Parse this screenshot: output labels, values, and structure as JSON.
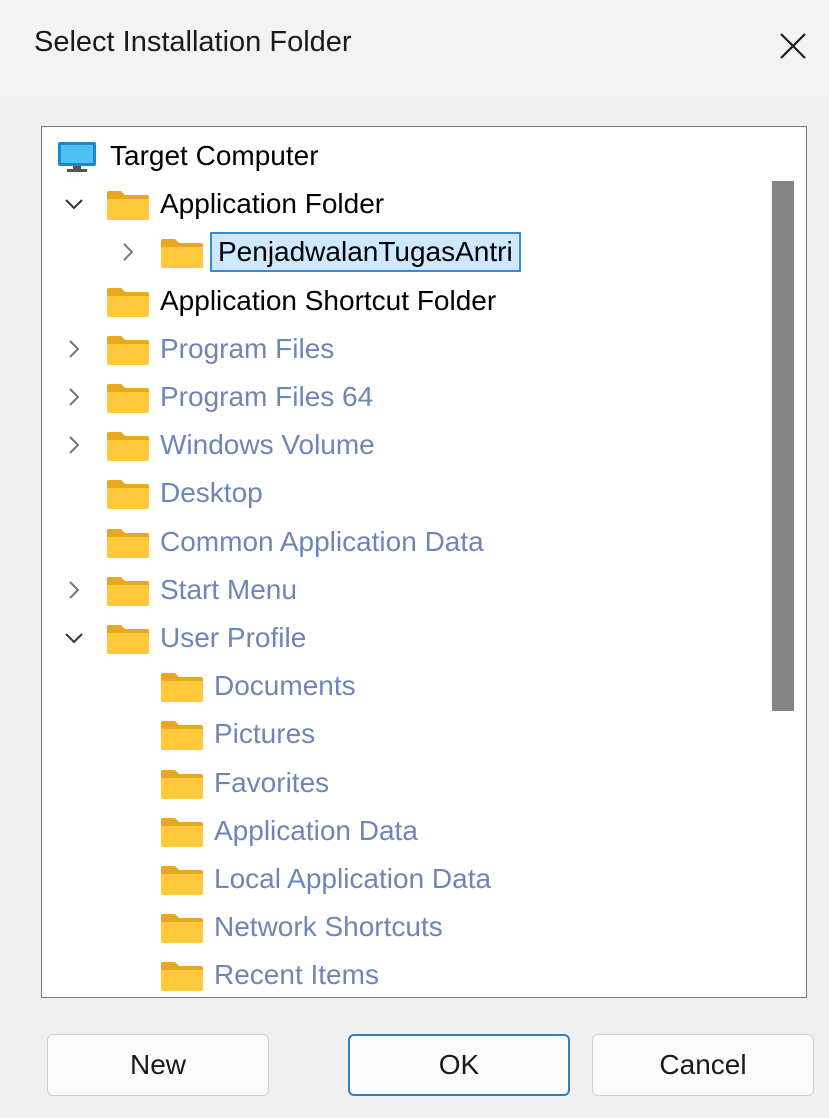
{
  "window": {
    "title": "Select Installation Folder",
    "close_glyph": "✕"
  },
  "tree": {
    "items": [
      {
        "label": "Target Computer",
        "icon": "computer-icon",
        "level": 0,
        "expander": "none",
        "style": "dark",
        "selected": false
      },
      {
        "label": "Application Folder",
        "icon": "folder-icon",
        "level": 1,
        "expander": "expanded",
        "style": "dark",
        "selected": false
      },
      {
        "label": "PenjadwalanTugasAntri",
        "icon": "folder-icon",
        "level": 2,
        "expander": "collapsed",
        "style": "dark",
        "selected": true
      },
      {
        "label": "Application Shortcut Folder",
        "icon": "folder-icon",
        "level": 1,
        "expander": "none",
        "style": "dark",
        "selected": false
      },
      {
        "label": "Program Files",
        "icon": "folder-icon",
        "level": 1,
        "expander": "collapsed",
        "style": "gray",
        "selected": false
      },
      {
        "label": "Program Files 64",
        "icon": "folder-icon",
        "level": 1,
        "expander": "collapsed",
        "style": "gray",
        "selected": false
      },
      {
        "label": "Windows Volume",
        "icon": "folder-icon",
        "level": 1,
        "expander": "collapsed",
        "style": "gray",
        "selected": false
      },
      {
        "label": "Desktop",
        "icon": "folder-icon",
        "level": 1,
        "expander": "none",
        "style": "gray",
        "selected": false
      },
      {
        "label": "Common Application Data",
        "icon": "folder-icon",
        "level": 1,
        "expander": "none",
        "style": "gray",
        "selected": false
      },
      {
        "label": "Start Menu",
        "icon": "folder-icon",
        "level": 1,
        "expander": "collapsed",
        "style": "gray",
        "selected": false
      },
      {
        "label": "User Profile",
        "icon": "folder-icon",
        "level": 1,
        "expander": "expanded",
        "style": "gray",
        "selected": false
      },
      {
        "label": "Documents",
        "icon": "folder-icon",
        "level": 2,
        "expander": "none",
        "style": "gray",
        "selected": false
      },
      {
        "label": "Pictures",
        "icon": "folder-icon",
        "level": 2,
        "expander": "none",
        "style": "gray",
        "selected": false
      },
      {
        "label": "Favorites",
        "icon": "folder-icon",
        "level": 2,
        "expander": "none",
        "style": "gray",
        "selected": false
      },
      {
        "label": "Application Data",
        "icon": "folder-icon",
        "level": 2,
        "expander": "none",
        "style": "gray",
        "selected": false
      },
      {
        "label": "Local Application Data",
        "icon": "folder-icon",
        "level": 2,
        "expander": "none",
        "style": "gray",
        "selected": false
      },
      {
        "label": "Network Shortcuts",
        "icon": "folder-icon",
        "level": 2,
        "expander": "none",
        "style": "gray",
        "selected": false
      },
      {
        "label": "Recent Items",
        "icon": "folder-icon",
        "level": 2,
        "expander": "none",
        "style": "gray",
        "selected": false
      }
    ]
  },
  "buttons": {
    "new_label": "New",
    "ok_label": "OK",
    "cancel_label": "Cancel"
  },
  "colors": {
    "accent": "#2f7fc1",
    "selection_bg": "#cde8ff",
    "selection_border": "#3a8ad8",
    "inactive_text": "#6d86b8",
    "folder_fill": "#ffc83d",
    "folder_tab": "#e8a623"
  }
}
